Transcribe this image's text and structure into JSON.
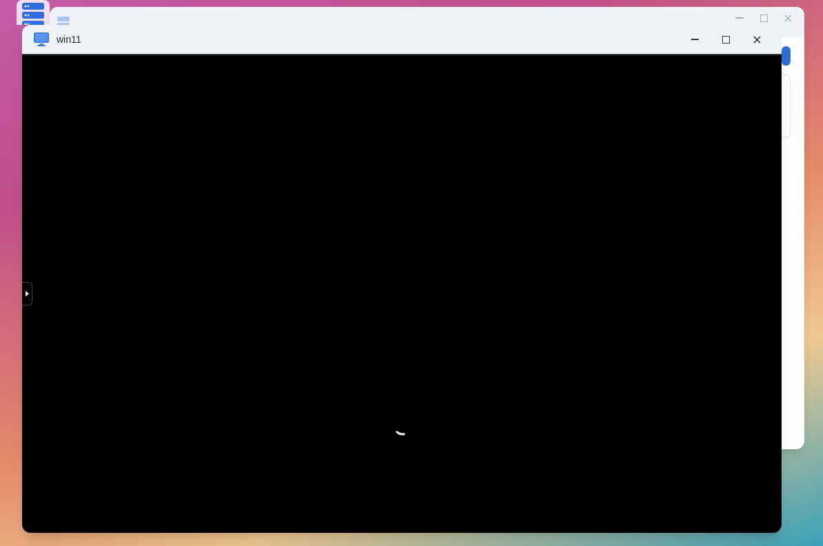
{
  "vm_window": {
    "title": "win11"
  }
}
